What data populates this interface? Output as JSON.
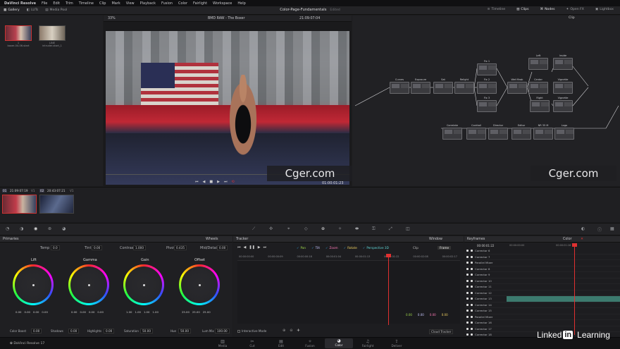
{
  "menubar": {
    "items": [
      "DaVinci Resolve",
      "File",
      "Edit",
      "Trim",
      "Timeline",
      "Clip",
      "Mark",
      "View",
      "Playback",
      "Fusion",
      "Color",
      "Fairlight",
      "Workspace",
      "Help"
    ]
  },
  "toolbar": {
    "gallery": "Gallery",
    "luts": "LUTs",
    "media_pool": "Media Pool",
    "project": "Color-Page-Fundamentals",
    "project_status": "Edited",
    "timeline": "Timeline",
    "clips": "Clips",
    "nodes": "Nodes",
    "open_fx": "Open FX",
    "lightbox": "Lightbox"
  },
  "clips": [
    {
      "id": "1",
      "label": "boxer-04-06.start"
    },
    {
      "id": "2",
      "label": "LINE",
      "sub": "intruder-start_1"
    }
  ],
  "viewer": {
    "zoom": "33%",
    "clip_name": "BMD RAW - The Boxer",
    "timecode": "21:09:07:04",
    "playhead_tc": "01:00:01:23",
    "watermark": "Cger.com"
  },
  "node_panel": {
    "mode": "Clip",
    "watermark": "Cger.com",
    "nodes": [
      "Curves",
      "Exposure",
      "Sat",
      "Relight",
      "Fix 1",
      "Fix 2",
      "Fix 3",
      "Wet Mask",
      "Left",
      "Inside",
      "Center",
      "Vignette",
      "Right",
      "Vignette",
      "Correlate",
      "Cocktail",
      "Director",
      "Editor",
      "NR 35 M",
      "Logo"
    ]
  },
  "timeline_strip": {
    "clip1_num": "01",
    "clip1_tc": "21:09:07:19",
    "clip1_track": "V1",
    "clip2_num": "02",
    "clip2_tc": "20:43:07:21",
    "clip2_track": "V1"
  },
  "primaries": {
    "title": "Primaries",
    "mode": "Wheels",
    "temp_label": "Temp",
    "temp": "0.0",
    "tint_label": "Tint",
    "tint": "0.00",
    "contrast_label": "Contrast",
    "contrast": "1.000",
    "pivot_label": "Pivot",
    "pivot": "0.435",
    "middetail_label": "Mid/Detail",
    "middetail": "0.00",
    "wheels": [
      {
        "name": "Lift",
        "vals": [
          "0.00",
          "0.00",
          "0.00",
          "0.00"
        ]
      },
      {
        "name": "Gamma",
        "vals": [
          "0.00",
          "0.00",
          "0.00",
          "0.00"
        ]
      },
      {
        "name": "Gain",
        "vals": [
          "1.00",
          "1.00",
          "1.00",
          "1.00"
        ]
      },
      {
        "name": "Offset",
        "vals": [
          "25.00",
          "25.00",
          "25.00",
          ""
        ]
      }
    ],
    "colorboost_label": "Color Boost",
    "colorboost": "0.00",
    "shadows_label": "Shadows",
    "shadows": "0.00",
    "highlights_label": "Highlights",
    "highlights": "0.00",
    "saturation_label": "Saturation",
    "saturation": "50.00",
    "hue_label": "Hue",
    "hue": "50.00",
    "lummix_label": "Lum Mix",
    "lummix": "100.00"
  },
  "tracker": {
    "title": "Tracker",
    "window": "Window",
    "pan": "Pan",
    "tilt": "Tilt",
    "zoom": "Zoom",
    "rotate": "Rotate",
    "perspective": "Perspective 3D",
    "clip": "Clip",
    "frame": "Frame",
    "ruler": [
      "00:00:00:00",
      "00:00:00:09",
      "00:00:00:18",
      "00:00:01:04",
      "00:00:01:13",
      "00:00:01:22",
      "00:00:02:08",
      "00:00:02:17"
    ],
    "vals": [
      "0.00",
      "0.00",
      "0.00",
      "0.00"
    ],
    "interactive": "Interactive Mode",
    "cloud": "Cloud Tracker"
  },
  "keyframes": {
    "title": "Keyframes",
    "color": "Color",
    "time": "00:00:01:22",
    "ruler": [
      "00:00:00:00",
      "00:00:01:16"
    ],
    "rows": [
      "Corrector 6",
      "Corrector 7",
      "Parallel Mixer",
      "Corrector 8",
      "Corrector 9",
      "Corrector 10",
      "Corrector 11",
      "Corrector 12",
      "Corrector 13",
      "Corrector 14",
      "Corrector 15",
      "Parallel Mixer",
      "Corrector 16",
      "Corrector 17",
      "Corrector 18",
      "Corrector 19",
      "Corrector 20"
    ]
  },
  "pages": [
    "Media",
    "Cut",
    "Edit",
    "Fusion",
    "Color",
    "Fairlight",
    "Deliver"
  ],
  "app_version": "DaVinci Resolve 17",
  "linkedin": {
    "text": "Linked",
    "in": "in",
    "learning": "Learning"
  },
  "colors": {
    "accent": "#e03030",
    "bg": "#1c1c1e"
  }
}
